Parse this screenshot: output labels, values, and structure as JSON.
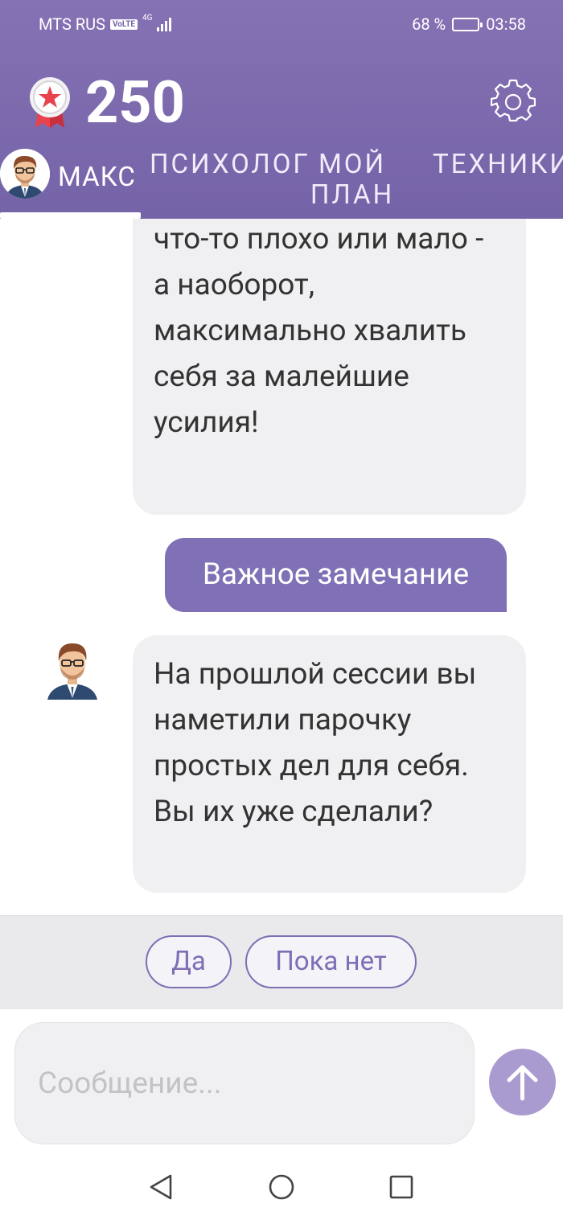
{
  "status_bar": {
    "carrier": "MTS RUS",
    "volte": "VoLTE",
    "network": "4G",
    "battery_percent": "68 %",
    "battery_level": 0.68,
    "time": "03:58"
  },
  "header": {
    "medal_icon": "medal-star-icon",
    "score": "250",
    "settings_icon": "gear-icon"
  },
  "tabs": [
    {
      "label": "МАКС",
      "active": true
    },
    {
      "label": "ПСИХОЛОГ",
      "active": false
    },
    {
      "label": "МОЙ ПЛАН",
      "active": false
    },
    {
      "label": "ТЕХНИКИ",
      "active": false
    }
  ],
  "chat": {
    "messages": [
      {
        "from": "bot",
        "text": "за то, что вы сделали что-то плохо или мало - а наоборот, максимально хвалить себя за малейшие усилия!"
      },
      {
        "from": "user",
        "text": "Важное замечание"
      },
      {
        "from": "bot",
        "text": "На прошлой сессии вы наметили парочку простых дел для себя. Вы их уже сделали?"
      }
    ]
  },
  "quick_replies": [
    "Да",
    "Пока нет"
  ],
  "composer": {
    "placeholder": "Сообщение...",
    "send_icon": "arrow-up-icon"
  },
  "colors": {
    "header": "#7563a8",
    "accent": "#8070b5",
    "send_button": "#a99bd0",
    "bubble_bot": "#f0f0f2"
  }
}
